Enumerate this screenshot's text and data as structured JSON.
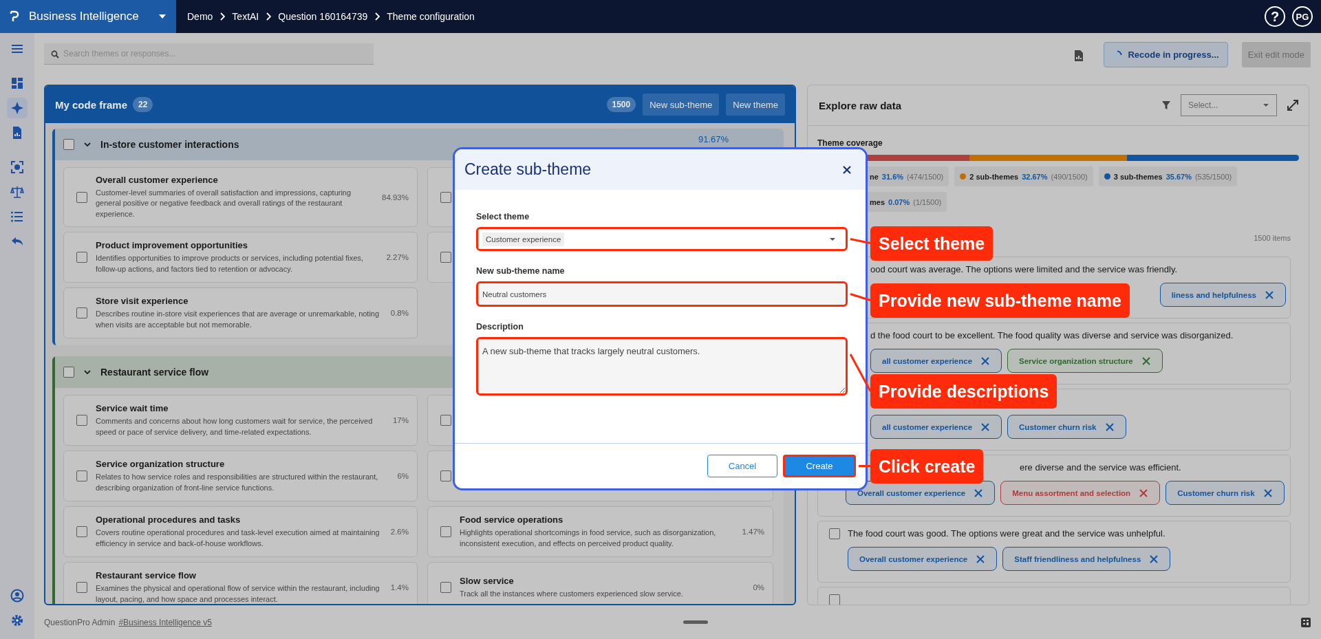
{
  "top_bar": {
    "app_name": "Business Intelligence",
    "breadcrumb": [
      "Demo",
      "TextAI",
      "Question 160164739",
      "Theme configuration"
    ],
    "help": "?",
    "avatar": "PG"
  },
  "sidebar": {
    "groups": [
      [
        {
          "kind": "menu",
          "selected": false
        }
      ],
      [
        {
          "kind": "dashboard",
          "selected": false
        },
        {
          "kind": "sparkle",
          "selected": true
        },
        {
          "kind": "report",
          "selected": false
        }
      ],
      [
        {
          "kind": "scan",
          "selected": false
        },
        {
          "kind": "scale",
          "selected": false
        },
        {
          "kind": "list",
          "selected": false
        },
        {
          "kind": "reply",
          "selected": false
        }
      ]
    ],
    "bottom_items": [
      {
        "kind": "user",
        "selected": false
      },
      {
        "kind": "settings",
        "selected": false
      }
    ]
  },
  "toolbar": {
    "search": {
      "placeholder": "Search themes or responses..."
    },
    "recode_button": "Recode in progress...",
    "exit_button": {
      "label": "Exit edit mode",
      "disabled": true
    }
  },
  "code_frame": {
    "title": "My code frame",
    "count": "22",
    "total": "1500",
    "buttons": [
      "New sub-theme",
      "New theme"
    ],
    "groups": [
      {
        "title": "In-store customer interactions",
        "percent": "91.67%",
        "color": "#1255a0",
        "checked": false,
        "expanded": true,
        "subthemes": [
          {
            "title": "Overall customer experience",
            "description": "Customer-level summaries of overall satisfaction and impressions, capturing general positive or negative feedback and overall ratings of the restaurant experience.",
            "percent": "84.93%",
            "checked": false
          },
          {
            "checked": false
          },
          {
            "title": "Product improvement opportunities",
            "description": "Identifies opportunities to improve products or services, including potential fixes, follow-up actions, and factors tied to retention or advocacy.",
            "percent": "2.27%",
            "checked": false
          },
          {
            "checked": false
          },
          {
            "title": "Store visit experience",
            "description": "Describes routine in-store visit experiences that are average or unremarkable, noting when visits are acceptable but not memorable.",
            "percent": "0.8%",
            "checked": false
          }
        ]
      },
      {
        "title": "Restaurant service flow",
        "color": "#2f6b2f",
        "checked": false,
        "expanded": true,
        "subthemes": [
          {
            "title": "Service wait time",
            "description": "Comments and concerns about how long customers wait for service, the perceived speed or pace of service delivery, and time-related expectations.",
            "percent": "17%",
            "checked": false
          },
          {
            "checked": false
          },
          {
            "title": "Service organization structure",
            "description": "Relates to how service roles and responsibilities are structured within the restaurant, describing organization of front-line service functions.",
            "percent": "6%",
            "checked": false
          },
          {
            "checked": false
          },
          {
            "title": "Operational procedures and tasks",
            "description": "Covers routine operational procedures and task-level execution aimed at maintaining efficiency in service and back-of-house workflows.",
            "percent": "2.6%",
            "checked": false
          },
          {
            "title": "Food service operations",
            "description": "Highlights operational shortcomings in food service, such as disorganization, inconsistent execution, and effects on perceived product quality.",
            "percent": "1.47%",
            "checked": false
          },
          {
            "title": "Restaurant service flow",
            "description": "Examines the physical and operational flow of service within the restaurant, including layout, pacing, and how space and processes interact.",
            "percent": "1.4%",
            "checked": false
          },
          {
            "title": "Slow service",
            "description": "Track all the instances where customers experienced slow service.",
            "percent": "0%",
            "checked": false
          }
        ]
      }
    ]
  },
  "explore": {
    "title": "Explore raw data",
    "filter_placeholder": "Select...",
    "coverage_label": "Theme coverage",
    "coverage": [
      {
        "kind": "clipped",
        "label": "ne",
        "percent": "31.6%",
        "count": "(474/1500)",
        "color": "#b04040"
      },
      {
        "kind": "full",
        "label": "2 sub-themes",
        "percent": "32.67%",
        "count": "(490/1500)",
        "color": "#c07000"
      },
      {
        "kind": "full",
        "label": "3 sub-themes",
        "percent": "35.67%",
        "count": "(535/1500)",
        "color": "#1255a0"
      },
      {
        "kind": "clipped",
        "label": "mes",
        "percent": "0.07%",
        "count": "(1/1500)"
      }
    ],
    "items_count": "1500 items",
    "rows": [
      {
        "kind": "right",
        "text": "ood court was average. The options were limited and the service was friendly.",
        "tags": [
          {
            "label": "liness and helpfulness",
            "color": "#1255a0"
          }
        ]
      },
      {
        "kind": "clipped",
        "text": "d the food court to be excellent. The food quality was diverse and service was disorganized.",
        "tags": [
          {
            "label": "all customer experience",
            "color": "#1255a0"
          },
          {
            "label": "Service organization structure",
            "color": "#2f6b2f"
          }
        ]
      },
      {
        "kind": "clipped",
        "tags": [
          {
            "label": "all customer experience",
            "color": "#1255a0"
          },
          {
            "label": "Customer churn risk",
            "color": "#1255a0"
          }
        ]
      },
      {
        "kind": "late",
        "text": "ere diverse and the service was efficient.",
        "tags": [
          {
            "label": "Overall customer experience",
            "color": "#1255a0"
          },
          {
            "label": "Menu assortment and selection",
            "color": "#b03a3a"
          },
          {
            "label": "Customer churn risk",
            "color": "#1255a0"
          }
        ]
      },
      {
        "kind": "full",
        "checked": false,
        "text": "The food court was good. The options were great and the service was unhelpful.",
        "tags": [
          {
            "label": "Overall customer experience",
            "color": "#1255a0"
          },
          {
            "label": "Staff friendliness and helpfulness",
            "color": "#1255a0"
          }
        ]
      },
      {
        "kind": "full",
        "checked": false
      }
    ]
  },
  "dialog": {
    "title": "Create sub-theme",
    "fields": [
      {
        "kind": "select",
        "label": "Select theme",
        "value": "Customer experience",
        "highlighted": true
      },
      {
        "kind": "text",
        "label": "New sub-theme name",
        "value": "Neutral customers",
        "highlighted": true
      },
      {
        "kind": "textarea",
        "label": "Description",
        "value": "A new sub-theme that tracks largely neutral customers.",
        "highlighted": true
      }
    ],
    "buttons": [
      {
        "kind": "secondary",
        "label": "Cancel",
        "highlighted": false
      },
      {
        "kind": "primary",
        "label": "Create",
        "highlighted": true
      }
    ]
  },
  "annotations": [
    {
      "label": "Select theme"
    },
    {
      "label": "Provide new sub-theme name"
    },
    {
      "label": "Provide descriptions"
    },
    {
      "label": "Click create"
    }
  ],
  "footer": {
    "org": "QuestionPro Admin",
    "link": "#Business Intelligence v5"
  }
}
